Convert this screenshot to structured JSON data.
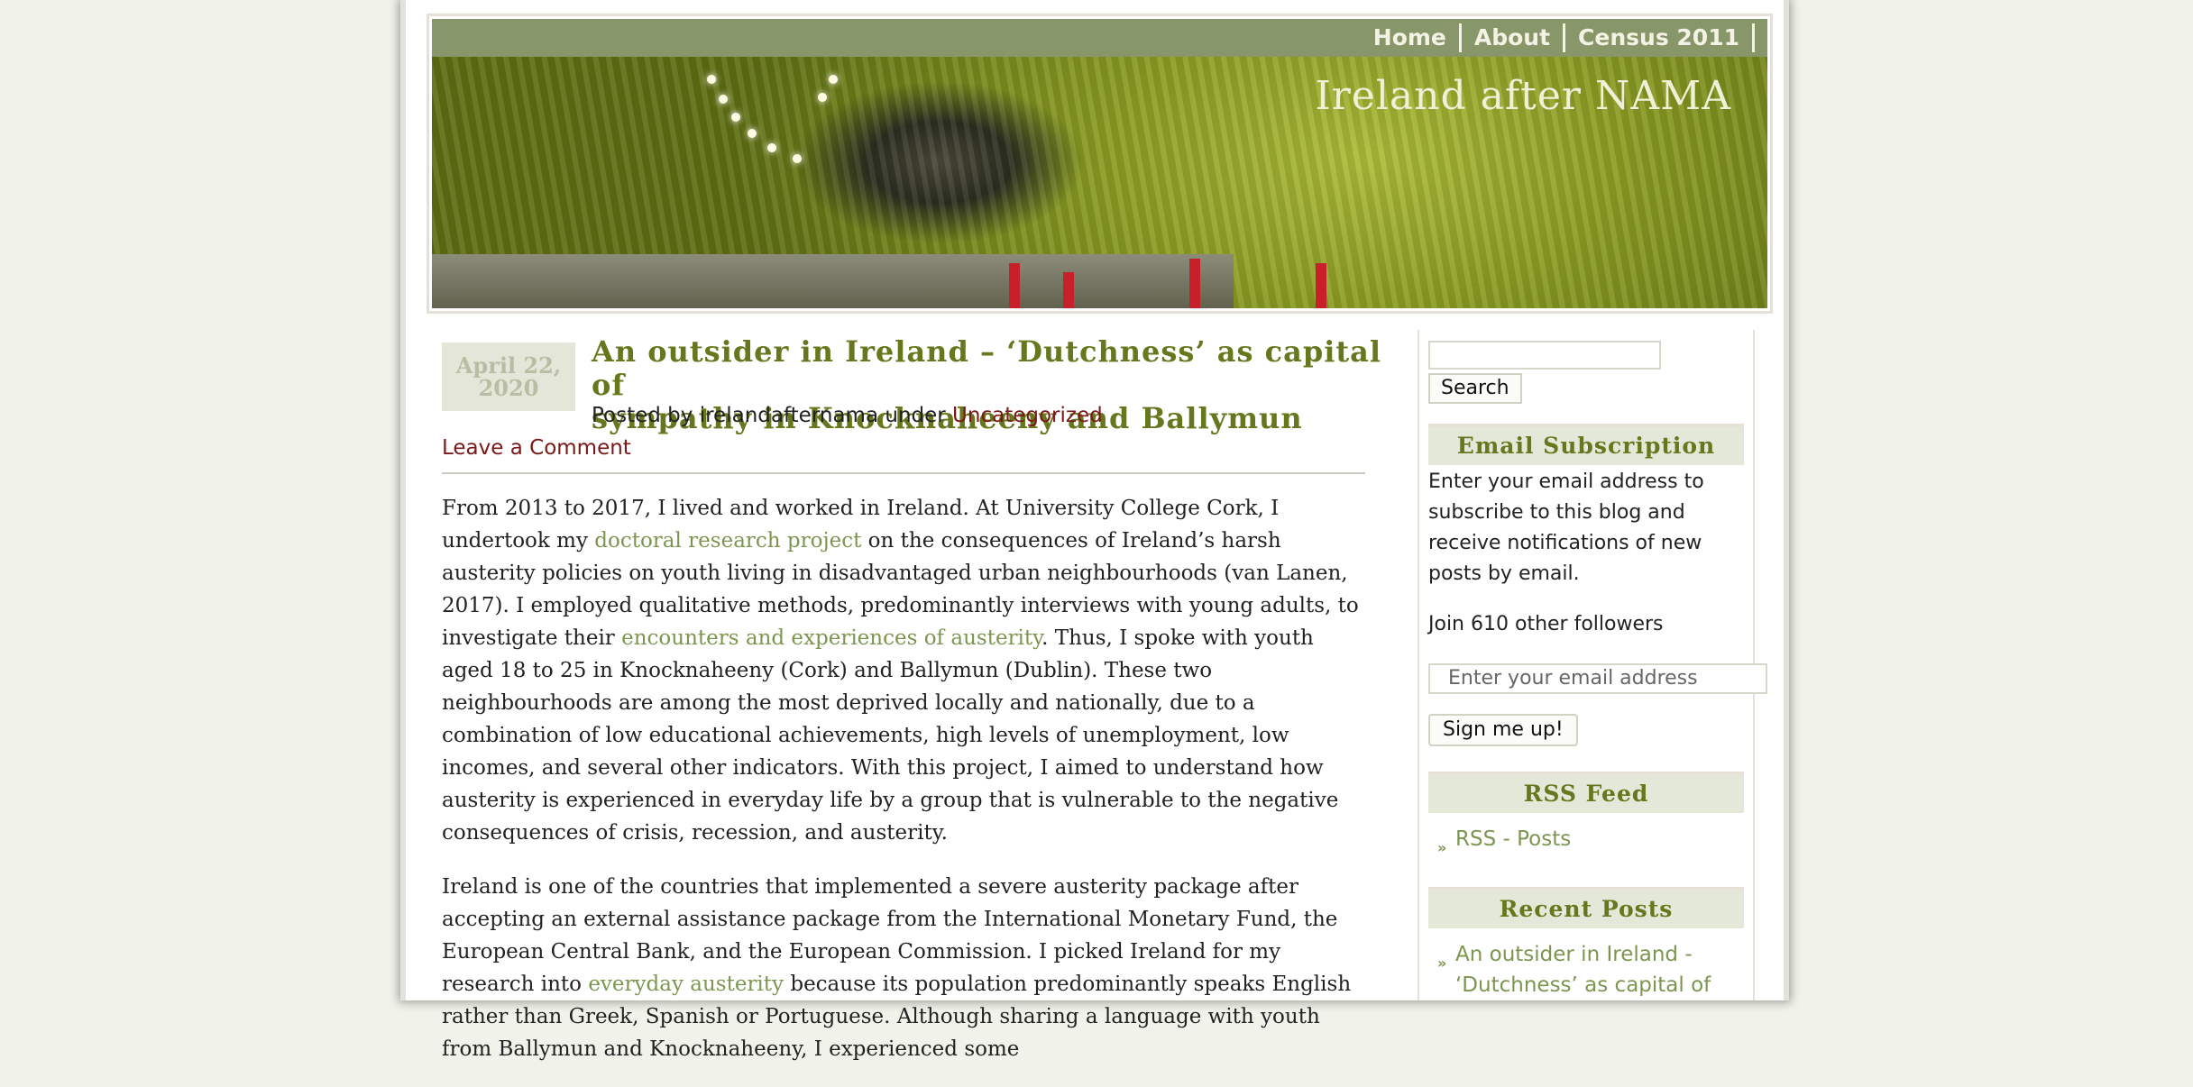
{
  "nav": {
    "items": [
      {
        "label": "Home"
      },
      {
        "label": "About"
      },
      {
        "label": "Census 2011"
      }
    ]
  },
  "site": {
    "title": "Ireland after NAMA"
  },
  "post": {
    "date": "April 22,\n2020",
    "date_line1": "April 22,",
    "date_line2": "2020",
    "title_line1": "An outsider in Ireland – ‘Dutchness’ as capital of",
    "title_line2": "sympathy in Knocknaheeny and Ballymun",
    "posted_by_prefix": "Posted by ",
    "author": "irelandafternama",
    "under": " under ",
    "category": "Uncategorized",
    "leave_comment": "Leave a Comment",
    "p1_a": "From 2013 to 2017, I lived and worked in Ireland. At University College Cork, I undertook my",
    "p1_link1": "doctoral research project",
    "p1_b": " on the consequences of Ireland’s harsh austerity policies on youth living in disadvantaged urban neighbourhoods (van Lanen, 2017). I employed qualitative methods, predominantly interviews with young adults, to investigate their ",
    "p1_link2": "encounters and experiences of austerity",
    "p1_c": ". Thus, I spoke with youth aged 18 to 25 in Knocknaheeny (Cork) and Ballymun (Dublin). These two neighbourhoods are among the most deprived locally and nationally, due to a combination of low educational achievements, high levels of unemployment, low incomes, and several other indicators. With this project, I aimed to understand how austerity is experienced in everyday life by a group that is vulnerable to the negative consequences of crisis, recession, and austerity.",
    "p2_a": "Ireland is one of the countries that implemented a severe austerity package after accepting an external assistance package from the International Monetary Fund, the European Central Bank, and the European Commission. I picked Ireland for my research into ",
    "p2_link": "everyday austerity",
    "p2_b": " because its population predominantly speaks English rather than Greek, Spanish or Portuguese. Although sharing a language with youth from Ballymun and Knocknaheeny, I experienced some"
  },
  "sidebar": {
    "search_button": "Search",
    "email_title": "Email Subscription",
    "email_text": "Enter your email address to subscribe to this blog and receive notifications of new posts by email.",
    "followers": "Join 610 other followers",
    "email_placeholder": "Enter your email address",
    "signup_button": "Sign me up!",
    "rss_title": "RSS Feed",
    "rss_link": "RSS - Posts",
    "recent_title": "Recent Posts",
    "recent_link": "An outsider in Ireland - ‘Dutchness’ as capital of"
  },
  "colors": {
    "nav_bg": "#879769",
    "title_green": "#66781e",
    "link_green": "#7c9650",
    "link_red": "#7a1818"
  }
}
